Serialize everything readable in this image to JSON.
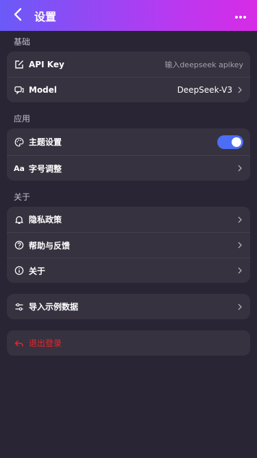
{
  "header": {
    "title": "设置",
    "back_icon": "chevron-left-icon",
    "more_icon": "more-horizontal-icon",
    "gradient": [
      "#6a5af7",
      "#d82be6"
    ]
  },
  "sections": {
    "basic": {
      "title": "基础",
      "api_key": {
        "label": "API Key",
        "placeholder": "输入deepseek apikey",
        "icon": "edit-icon"
      },
      "model": {
        "label": "Model",
        "value": "DeepSeek-V3",
        "icon": "chat-bubbles-icon"
      }
    },
    "app": {
      "title": "应用",
      "theme": {
        "label": "主题设置",
        "icon": "palette-icon",
        "toggle_on": true,
        "toggle_color": "#4c6ef5"
      },
      "font_size": {
        "label": "字号调整",
        "icon_text": "Aa"
      }
    },
    "about": {
      "title": "关于",
      "privacy": {
        "label": "隐私政策",
        "icon": "bell-icon"
      },
      "help": {
        "label": "帮助与反馈",
        "icon": "question-circle-icon"
      },
      "about": {
        "label": "关于",
        "icon": "info-circle-icon"
      }
    },
    "import": {
      "label": "导入示例数据",
      "icon": "sliders-icon"
    },
    "logout": {
      "label": "退出登录",
      "icon": "logout-arrow-icon",
      "color": "#e8262e"
    }
  }
}
